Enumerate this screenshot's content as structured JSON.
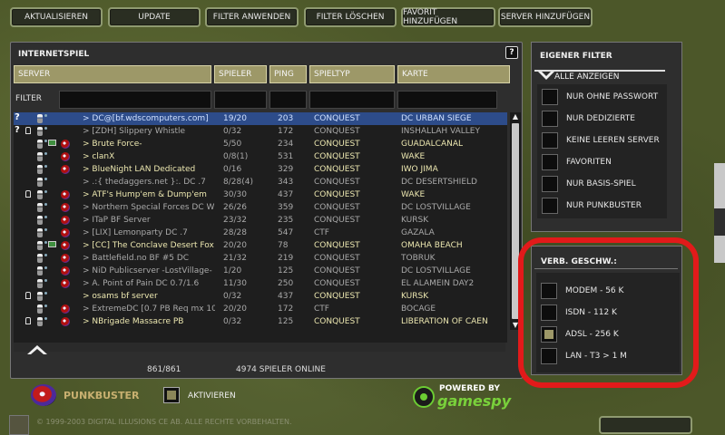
{
  "toolbar": {
    "buttons": [
      "AKTUALISIEREN",
      "UPDATE",
      "FILTER ANWENDEN",
      "FILTER LÖSCHEN",
      "FAVORIT HINZUFÜGEN",
      "SERVER HINZUFÜGEN"
    ]
  },
  "server_panel": {
    "title": "INTERNETSPIEL",
    "help": "?",
    "columns": [
      "SERVER",
      "SPIELER",
      "PING",
      "SPIELTYP",
      "KARTE"
    ],
    "filter_label": "FILTER",
    "rows": [
      {
        "q": "?",
        "lock": false,
        "pc": false,
        "pb": false,
        "name": "> DC@[bf.wdscomputers.com]",
        "players": "19/20",
        "ping": "203",
        "type": "CONQUEST",
        "map": "DC URBAN SIEGE",
        "style": "sel"
      },
      {
        "q": "?",
        "lock": true,
        "pc": false,
        "pb": false,
        "name": "> [ZDH] Slippery Whistle",
        "players": "0/32",
        "ping": "172",
        "type": "CONQUEST",
        "map": "INSHALLAH VALLEY",
        "style": "dim"
      },
      {
        "q": "",
        "lock": false,
        "pc": true,
        "pb": true,
        "name": "> Brute Force-",
        "players": "5/50",
        "ping": "234",
        "type": "CONQUEST",
        "map": "GUADALCANAL",
        "style": "bright"
      },
      {
        "q": "",
        "lock": false,
        "pc": false,
        "pb": true,
        "name": "> clanX",
        "players": "0/8(1)",
        "ping": "531",
        "type": "CONQUEST",
        "map": "WAKE",
        "style": "bright"
      },
      {
        "q": "",
        "lock": false,
        "pc": false,
        "pb": true,
        "name": "> BlueNight LAN Dedicated",
        "players": "0/16",
        "ping": "329",
        "type": "CONQUEST",
        "map": "IWO JIMA",
        "style": "bright"
      },
      {
        "q": "",
        "lock": false,
        "pc": false,
        "pb": false,
        "name": "> .:{ thedaggers.net }:. DC .7",
        "players": "8/28(4)",
        "ping": "343",
        "type": "CONQUEST",
        "map": "DC DESERTSHIELD",
        "style": "dim"
      },
      {
        "q": "",
        "lock": true,
        "pc": false,
        "pb": true,
        "name": "> ATF's Hump'em & Dump'em",
        "players": "30/30",
        "ping": "437",
        "type": "CONQUEST",
        "map": "WAKE",
        "style": "bright"
      },
      {
        "q": "",
        "lock": false,
        "pc": false,
        "pb": true,
        "name": "> Northern Special Forces DC W",
        "players": "26/26",
        "ping": "359",
        "type": "CONQUEST",
        "map": "DC LOSTVILLAGE",
        "style": "dim"
      },
      {
        "q": "",
        "lock": false,
        "pc": false,
        "pb": true,
        "name": "> ITaP BF Server",
        "players": "23/32",
        "ping": "235",
        "type": "CONQUEST",
        "map": "KURSK",
        "style": "dim"
      },
      {
        "q": "",
        "lock": false,
        "pc": false,
        "pb": true,
        "name": "> [LIX] Lemonparty DC .7",
        "players": "28/28",
        "ping": "547",
        "type": "CTF",
        "map": "GAZALA",
        "style": "dim"
      },
      {
        "q": "",
        "lock": false,
        "pc": true,
        "pb": true,
        "name": "> [CC] The Conclave Desert Fox",
        "players": "20/20",
        "ping": "78",
        "type": "CONQUEST",
        "map": "OMAHA BEACH",
        "style": "bright"
      },
      {
        "q": "",
        "lock": false,
        "pc": false,
        "pb": true,
        "name": "> Battlefield.no BF #5 DC",
        "players": "21/32",
        "ping": "219",
        "type": "CONQUEST",
        "map": "TOBRUK",
        "style": "dim"
      },
      {
        "q": "",
        "lock": false,
        "pc": false,
        "pb": true,
        "name": "> NiD Publicserver -LostVillage-",
        "players": "1/20",
        "ping": "125",
        "type": "CONQUEST",
        "map": "DC LOSTVILLAGE",
        "style": "dim"
      },
      {
        "q": "",
        "lock": false,
        "pc": false,
        "pb": true,
        "name": "> A. Point of Pain DC 0.7/1.6",
        "players": "11/30",
        "ping": "250",
        "type": "CONQUEST",
        "map": "EL ALAMEIN DAY2",
        "style": "dim"
      },
      {
        "q": "",
        "lock": true,
        "pc": false,
        "pb": false,
        "name": "> osams bf server",
        "players": "0/32",
        "ping": "437",
        "type": "CONQUEST",
        "map": "KURSK",
        "style": "bright"
      },
      {
        "q": "",
        "lock": false,
        "pc": false,
        "pb": true,
        "name": "> ExtremeDC [0.7 PB Req mx 10",
        "players": "20/20",
        "ping": "172",
        "type": "CTF",
        "map": "BOCAGE",
        "style": "dim"
      },
      {
        "q": "",
        "lock": true,
        "pc": false,
        "pb": true,
        "name": "> NBrigade Massacre PB",
        "players": "0/32",
        "ping": "125",
        "type": "CONQUEST",
        "map": "LIBERATION OF CAEN",
        "style": "bright"
      }
    ],
    "status_count": "861/861",
    "status_online": "4974  SPIELER ONLINE"
  },
  "filter_panel": {
    "title": "EIGENER FILTER",
    "show_all": "ALLE ANZEIGEN",
    "options": [
      {
        "label": "NUR OHNE PASSWORT",
        "checked": false
      },
      {
        "label": "NUR DEDIZIERTE",
        "checked": false
      },
      {
        "label": "KEINE LEEREN SERVER",
        "checked": false
      },
      {
        "label": "FAVORITEN",
        "checked": false
      },
      {
        "label": "NUR BASIS-SPIEL",
        "checked": false
      },
      {
        "label": "NUR PUNKBUSTER",
        "checked": false
      }
    ]
  },
  "speed_panel": {
    "title": "VERB. GESCHW.:",
    "options": [
      {
        "label": "MODEM - 56 K",
        "checked": false
      },
      {
        "label": "ISDN - 112 K",
        "checked": false
      },
      {
        "label": "ADSL - 256 K",
        "checked": true
      },
      {
        "label": "LAN - T3 > 1 M",
        "checked": false
      }
    ]
  },
  "footer": {
    "punkbuster": "PUNKBUSTER",
    "activate_label": "AKTIVIEREN",
    "gamespy_powered": "POWERED BY",
    "gamespy_name": "gamespy",
    "copyright": "© 1999-2003 DIGITAL ILLUSIONS CE AB. ALLE RECHTE VORBEHALTEN."
  },
  "colors": {
    "annotation": "#e21a1a",
    "header": "#9d9868",
    "selected_row": "#2d4c8a"
  }
}
